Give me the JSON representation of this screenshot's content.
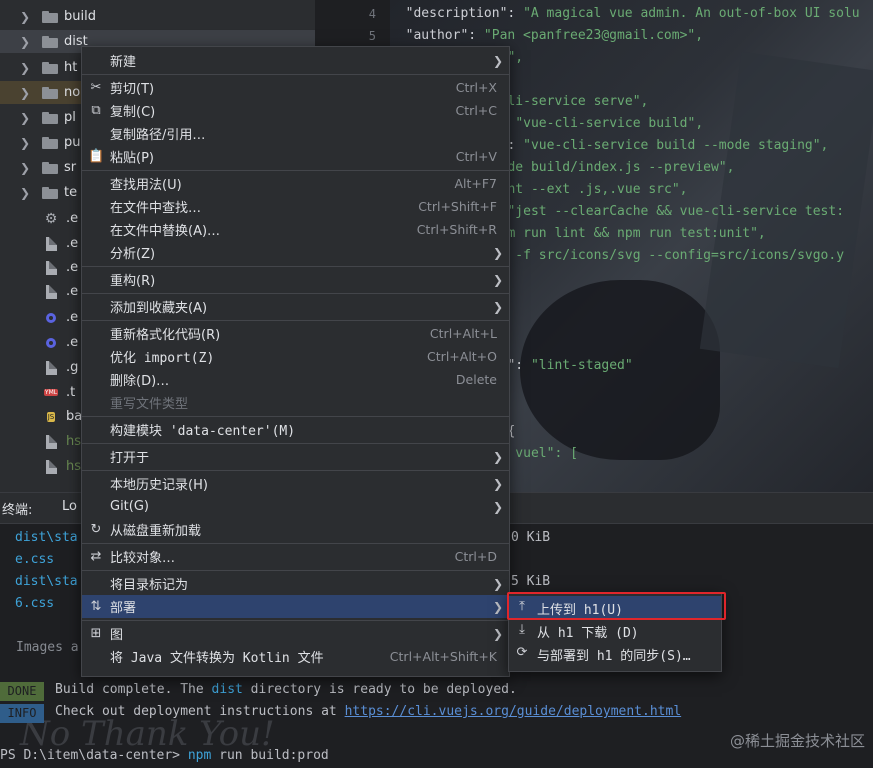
{
  "tree": {
    "items": [
      {
        "kind": "folder",
        "label": "build"
      },
      {
        "kind": "folder",
        "label": "dist"
      },
      {
        "kind": "folder",
        "label": "ht"
      },
      {
        "kind": "folder",
        "label": "no"
      },
      {
        "kind": "folder",
        "label": "pl"
      },
      {
        "kind": "folder",
        "label": "pu"
      },
      {
        "kind": "folder",
        "label": "sr"
      },
      {
        "kind": "folder",
        "label": "te"
      },
      {
        "kind": "file",
        "icon": "gear",
        "label": ".e"
      },
      {
        "kind": "file",
        "icon": "doc",
        "label": ".e"
      },
      {
        "kind": "file",
        "icon": "doc",
        "label": ".e"
      },
      {
        "kind": "file",
        "icon": "doc",
        "label": ".e"
      },
      {
        "kind": "file",
        "icon": "ring",
        "label": ".e"
      },
      {
        "kind": "file",
        "icon": "ring",
        "label": ".e"
      },
      {
        "kind": "file",
        "icon": "doc",
        "label": ".g"
      },
      {
        "kind": "file",
        "icon": "yml",
        "label": ".t"
      },
      {
        "kind": "file",
        "icon": "js",
        "label": "ba"
      },
      {
        "kind": "file",
        "icon": "doc",
        "label": "hs"
      },
      {
        "kind": "file",
        "icon": "doc",
        "label": "hs"
      }
    ]
  },
  "editor": {
    "line_numbers": [
      "4",
      "5"
    ],
    "lines": [
      {
        "pre": "  \"description\": ",
        "str": "\"A magical vue admin. An out-of-box UI solu"
      },
      {
        "pre": "  \"author\": ",
        "str": "\"Pan <panfree23@gmail.com>\","
      },
      {
        "pre": "",
        "str": "MIT\","
      },
      {
        "pre": "",
        "str": ""
      },
      {
        "pre": "",
        "str": "e-cli-service serve\","
      },
      {
        "pre": "d\": ",
        "str": "\"vue-cli-service build\","
      },
      {
        "pre": "ge\": ",
        "str": "\"vue-cli-service build --mode staging\","
      },
      {
        "pre": "",
        "str": "\"node build/index.js --preview\","
      },
      {
        "pre": "",
        "str": "slint --ext .js,.vue src\","
      },
      {
        "pre": "\": ",
        "str": "\"jest --clearCache && vue-cli-service test:"
      },
      {
        "pre": "",
        "str": "\"npm run lint && npm run test:unit\","
      },
      {
        "pre": "",
        "str": "vgo -f src/icons/svg --config=src/icons/svgo.y"
      },
      {
        "pre": "",
        "str": "op\""
      },
      {
        "pre": "",
        "str": ""
      },
      {
        "pre": "",
        "str": ""
      },
      {
        "pre": "",
        "str": ""
      },
      {
        "pre": "mit\": ",
        "str": "\"lint-staged\""
      },
      {
        "pre": "",
        "str": ""
      },
      {
        "pre": "",
        "str": ""
      },
      {
        "pre": "\": {",
        "str": ""
      },
      {
        "pre": "",
        "str": "fis vuel\": ["
      }
    ]
  },
  "terminal": {
    "tab_label": "终端:",
    "tab_name": "Lo",
    "lines": [
      {
        "text": "dist\\sta",
        "size": "0 KiB"
      },
      {
        "text": "e.css",
        "size": ""
      },
      {
        "text": "dist\\sta",
        "size": "5 KiB"
      },
      {
        "text": "6.css",
        "size": ""
      }
    ],
    "images_text": "Images a",
    "done_badge": "DONE",
    "done_pre": "Build complete. The ",
    "done_hl": "dist",
    "done_post": " directory is ready to be deployed.",
    "info_badge": "INFO",
    "info_pre": "Check out deployment instructions at ",
    "info_link": "https://cli.vuejs.org/guide/deployment.html",
    "prompt": "PS D:\\item\\data-center> ",
    "cmd_kw": "npm",
    "cmd_rest": " run build:prod",
    "ghost_text": "No Thank You!",
    "watermark": "@稀土掘金技术社区"
  },
  "context_menu": {
    "items": [
      {
        "label": "新建",
        "shortcut": "",
        "submenu": true,
        "icon": ""
      },
      {
        "sep": true
      },
      {
        "label": "剪切(T)",
        "shortcut": "Ctrl+X",
        "icon": "✂"
      },
      {
        "label": "复制(C)",
        "shortcut": "Ctrl+C",
        "icon": "⧉"
      },
      {
        "label": "复制路径/引用…",
        "shortcut": "",
        "icon": ""
      },
      {
        "label": "粘贴(P)",
        "shortcut": "Ctrl+V",
        "icon": "📋"
      },
      {
        "sep": true
      },
      {
        "label": "查找用法(U)",
        "shortcut": "Alt+F7",
        "icon": ""
      },
      {
        "label": "在文件中查找…",
        "shortcut": "Ctrl+Shift+F",
        "icon": ""
      },
      {
        "label": "在文件中替换(A)…",
        "shortcut": "Ctrl+Shift+R",
        "icon": ""
      },
      {
        "label": "分析(Z)",
        "shortcut": "",
        "submenu": true,
        "icon": ""
      },
      {
        "sep": true
      },
      {
        "label": "重构(R)",
        "shortcut": "",
        "submenu": true,
        "icon": ""
      },
      {
        "sep": true
      },
      {
        "label": "添加到收藏夹(A)",
        "shortcut": "",
        "submenu": true,
        "icon": ""
      },
      {
        "sep": true
      },
      {
        "label": "重新格式化代码(R)",
        "shortcut": "Ctrl+Alt+L",
        "icon": ""
      },
      {
        "label": "优化 import(Z)",
        "shortcut": "Ctrl+Alt+O",
        "icon": ""
      },
      {
        "label": "删除(D)…",
        "shortcut": "Delete",
        "icon": ""
      },
      {
        "label": "重写文件类型",
        "shortcut": "",
        "icon": "",
        "disabled": true
      },
      {
        "sep": true
      },
      {
        "label": "构建模块 'data-center'(M)",
        "shortcut": "",
        "icon": ""
      },
      {
        "sep": true
      },
      {
        "label": "打开于",
        "shortcut": "",
        "submenu": true,
        "icon": ""
      },
      {
        "sep": true
      },
      {
        "label": "本地历史记录(H)",
        "shortcut": "",
        "submenu": true,
        "icon": ""
      },
      {
        "label": "Git(G)",
        "shortcut": "",
        "submenu": true,
        "icon": ""
      },
      {
        "label": "从磁盘重新加载",
        "shortcut": "",
        "icon": "↻"
      },
      {
        "sep": true
      },
      {
        "label": "比较对象…",
        "shortcut": "Ctrl+D",
        "icon": "⇄"
      },
      {
        "sep": true
      },
      {
        "label": "将目录标记为",
        "shortcut": "",
        "submenu": true,
        "icon": ""
      },
      {
        "label": "部署",
        "shortcut": "",
        "submenu": true,
        "icon": "⇅",
        "hover": true
      },
      {
        "sep": true
      },
      {
        "label": "图",
        "shortcut": "",
        "submenu": true,
        "icon": "⊞"
      },
      {
        "label": "将 Java 文件转换为 Kotlin 文件",
        "shortcut": "Ctrl+Alt+Shift+K",
        "icon": ""
      }
    ]
  },
  "submenu": {
    "items": [
      {
        "label": "上传到 h1(U)",
        "icon": "⤒",
        "hover": true
      },
      {
        "label": "从 h1 下载 (D)",
        "icon": "⤓"
      },
      {
        "label": "与部署到 h1 的同步(S)…",
        "icon": "⟳"
      }
    ]
  },
  "colors": {
    "accent_highlight": "#2e436e",
    "annotation_red": "#e0262b"
  }
}
